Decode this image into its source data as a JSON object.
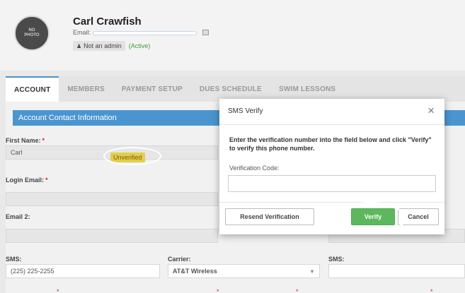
{
  "header": {
    "name": "Carl Crawfish",
    "email_label": "Email:",
    "avatar_line1": "NO",
    "avatar_line2": "PHOTO",
    "admin_status": "Not an admin",
    "account_status": "(Active)"
  },
  "tabs": [
    {
      "label": "ACCOUNT"
    },
    {
      "label": "MEMBERS"
    },
    {
      "label": "PAYMENT SETUP"
    },
    {
      "label": "DUES SCHEDULE"
    },
    {
      "label": "SWIM LESSONS"
    }
  ],
  "form": {
    "section_title": "Account Contact Information",
    "first_name_label": "First Name:",
    "first_name_value": "Carl",
    "login_email_label": "Login Email:",
    "email2_label": "Email 2:",
    "sms_label": "SMS:",
    "sms_value": "(225) 225-2255",
    "sms_status": "Unverified",
    "carrier_label": "Carrier:",
    "carrier_value": "AT&T Wireless",
    "sms2_label": "SMS:",
    "required_marker": "*"
  },
  "modal": {
    "title": "SMS Verify",
    "close_glyph": "×",
    "message": "Enter the verification number into the field below and click \"Verify\" to verify this phone number.",
    "code_label": "Verification Code:",
    "code_value": "",
    "resend_label": "Resend Verification",
    "verify_label": "Verify",
    "cancel_label": "Cancel"
  },
  "colors": {
    "accent": "#4a95cf",
    "verify_green": "#5cb85c",
    "unverified_yellow": "#e4cd4a",
    "active_green": "#3a9e3a",
    "required_red": "#d22222"
  }
}
